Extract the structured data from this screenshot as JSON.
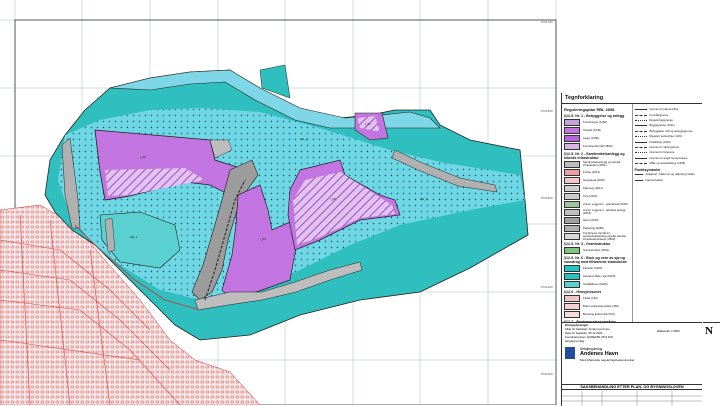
{
  "legend": {
    "title": "Tegnforklaring",
    "act": "Reguleringsplan PBL 2008",
    "sections": [
      {
        "title": "§12-5. Nr. 1 - Bebyggelse og anlegg",
        "items": [
          {
            "code": "",
            "label": "Forretninger (1150)",
            "color": "#c9a0dc"
          },
          {
            "code": "",
            "label": "Industri (1340)",
            "color": "#c274e0"
          },
          {
            "code": "",
            "label": "Lager (1350)",
            "color": "#b565d9"
          },
          {
            "code": "",
            "label": "Kombinertformål (1800)",
            "color": "#d9b3e6"
          }
        ]
      },
      {
        "title": "§12-5. Nr. 2 - Samferdselsanlegg og teknisk infrastruktur",
        "items": [
          {
            "code": "",
            "label": "Samferdselsanlegg og teknisk infrastruktur (2001)",
            "color": "#bdbdbd"
          },
          {
            "code": "",
            "label": "Fortau (2012)",
            "color": "#e8a0a0"
          },
          {
            "code": "",
            "label": "Gangareal (2016)",
            "color": "#f0c8c8"
          },
          {
            "code": "",
            "label": "Kjøreveg (2011)",
            "color": "#d0d0d0"
          },
          {
            "code": "",
            "label": "Torg (2014)",
            "color": "#cccccc"
          },
          {
            "code": "",
            "label": "Annen veggrunn - grøntareal (2019)",
            "color": "#9fc59f"
          },
          {
            "code": "",
            "label": "Annen veggrunn - tekniske anlegg (2018)",
            "color": "#c0c0c0"
          },
          {
            "code": "",
            "label": "Havn (2040)",
            "color": "#a0a0a0"
          },
          {
            "code": "",
            "label": "Parkering (2080)",
            "color": "#b0b0b0"
          },
          {
            "code": "",
            "label": "Kombinerte formål for samferdselsanlegg og/eller teknisk infrastrukturtraseer (2800)",
            "color": "#d8d8d8"
          }
        ]
      },
      {
        "title": "§12-5. Nr. 3 - Grønnstruktur",
        "items": [
          {
            "code": "",
            "label": "Grønnstruktur (3001)",
            "color": "#7ec87e"
          }
        ]
      },
      {
        "title": "§12-5. Nr. 6 - Bruk og vern av sjø og vassdrag med tilhørende strandsone",
        "items": [
          {
            "code": "",
            "label": "Farleder (6100)",
            "color": "#26c4c4"
          },
          {
            "code": "",
            "label": "Havneområde i sjø (6220)",
            "color": "#2fbfbf"
          },
          {
            "code": "",
            "label": "Småbåthavn (6230)",
            "color": "#5bd0d0"
          }
        ]
      },
      {
        "title": "§12-6 - Hensynssoner",
        "items": [
          {
            "code": "",
            "label": "Frisikt (140)",
            "color": "#f2c6c6"
          },
          {
            "code": "",
            "label": "Brann-/eksplosjonsfare (350)",
            "color": "#f5d0d0"
          },
          {
            "code": "",
            "label": "Bevaring kulturmiljø (570)",
            "color": "#f8dada"
          }
        ]
      },
      {
        "title": "§12-7 - Bestemmelsesområder",
        "items": [
          {
            "code": "",
            "label": "Utbyggingsavtaler / utfylling i",
            "color": "#ffffff"
          }
        ]
      }
    ],
    "lines": [
      "Grense for planområde",
      "Formålsgrense",
      "Reguleringsgrense",
      "Byggegrense (1211)",
      "Bebyggelse mål og anleggsgrense",
      "Regulert senterlinje (1221)",
      "Frisiktlinje (1222)",
      "Grense for sikringssone",
      "Grense for faresone",
      "Grense for angitt hensynssone",
      "Måle og avstandslinje (1259)"
    ],
    "points_title": "Punktsymboler",
    "points": [
      "Avkjørsel - både inn og utkjøring (1242)",
      "Fjernes/veiker"
    ]
  },
  "titleblock": {
    "rows": [
      "Kartopplysninger",
      "Kilde for basiskart:   Andøy kommune",
      "Dato for basiskart:   05.12.2022",
      "Koordinatsystem:   EUREF89 UTM 33N",
      "Høydegrunnlag:"
    ],
    "scale_label": "Målestokk:",
    "scale": "1:5000",
    "project": "Detaljregulering",
    "name": "Andenes Havn",
    "subtitle": "Med tilhørende reguleringsbestemmelser",
    "bar": "SAKSBEHANDLING ETTER PLAN- OG BYGNINGSLOVEN"
  },
  "north": "N",
  "colors": {
    "sea": "#2fbfbf",
    "light_sea": "#6dd8e3",
    "industry": "#c274e0",
    "hatch": "#8a3fb0",
    "land": "#f4e7e7",
    "urban_line": "#cc3333",
    "boundary": "#222222"
  }
}
